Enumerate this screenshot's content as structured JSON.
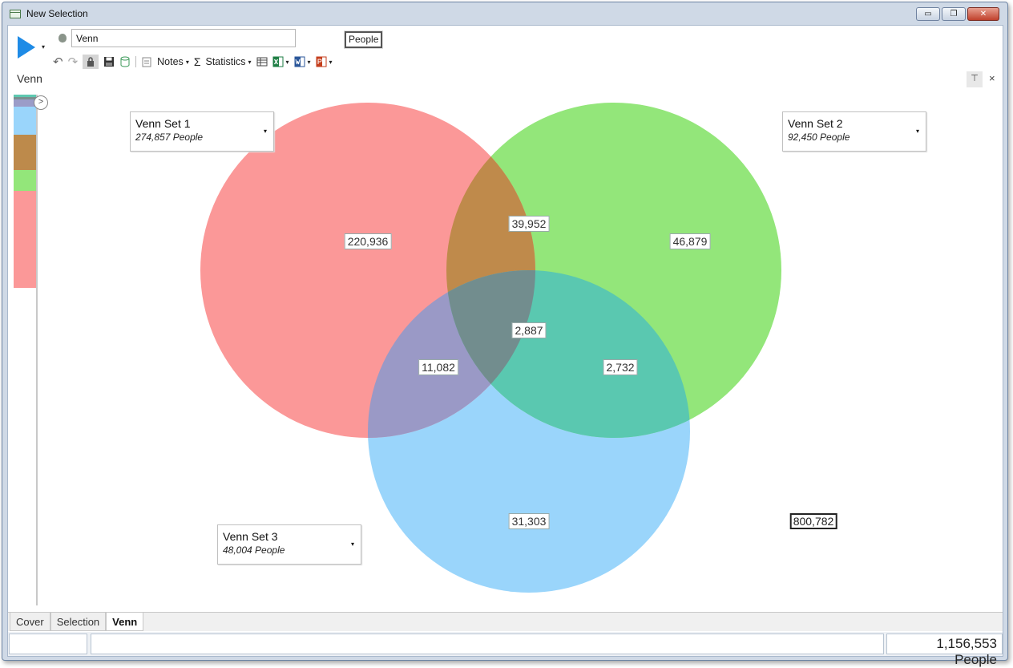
{
  "window": {
    "title": "New Selection",
    "controls": {
      "minimize": "▭",
      "restore": "❐",
      "close": "✕"
    }
  },
  "toolbar": {
    "selection_name": "Venn",
    "units_label": "People",
    "notes_label": "Notes",
    "statistics_label": "Statistics",
    "sigma": "Σ",
    "caret": "▾",
    "undo": "↶",
    "redo": "↷"
  },
  "panel": {
    "title": "Venn",
    "pin": "⊤",
    "close": "×",
    "expand": ">"
  },
  "sidebar_segments": [
    {
      "color": "#5ec8b0",
      "fraction": 0.004
    },
    {
      "color": "#7a8f8f",
      "fraction": 0.005
    },
    {
      "color": "#9b9cc8",
      "fraction": 0.015
    },
    {
      "color": "#9ad5fb",
      "fraction": 0.054
    },
    {
      "color": "#bd8a4b",
      "fraction": 0.069
    },
    {
      "color": "#93e67a",
      "fraction": 0.041
    },
    {
      "color": "#fb9898",
      "fraction": 0.191
    }
  ],
  "venn": {
    "colors": {
      "set1": "#fb9898",
      "set2": "#93e67a",
      "set3": "#9ad5fb",
      "set1_set2": "#bf8a4b",
      "set1_set3": "#9a99c6",
      "set2_set3": "#5ac8b0",
      "all": "#728d8e"
    },
    "sets": [
      {
        "name": "Venn Set 1",
        "count": "274,857 People"
      },
      {
        "name": "Venn Set 2",
        "count": "92,450 People"
      },
      {
        "name": "Venn Set 3",
        "count": "48,004 People"
      }
    ],
    "regions": {
      "only1": "220,936",
      "only2": "46,879",
      "only3": "31,303",
      "s1_s2": "39,952",
      "s1_s3": "11,082",
      "s2_s3": "2,732",
      "all": "2,887"
    },
    "outside": "800,782"
  },
  "tabs": [
    "Cover",
    "Selection",
    "Venn"
  ],
  "status": {
    "total": "1,156,553 People"
  }
}
